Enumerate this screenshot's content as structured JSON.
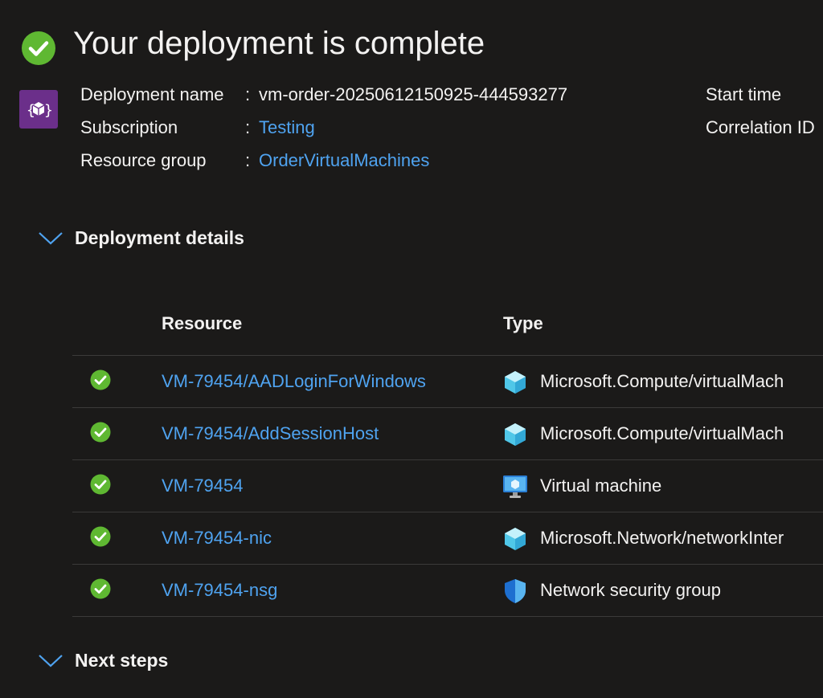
{
  "page": {
    "title": "Your deployment is complete"
  },
  "info": {
    "deployment_name_label": "Deployment name",
    "deployment_name_value": "vm-order-20250612150925-444593277",
    "subscription_label": "Subscription",
    "subscription_value": "Testing",
    "resource_group_label": "Resource group",
    "resource_group_value": "OrderVirtualMachines",
    "start_time_label": "Start time",
    "correlation_id_label": "Correlation ID",
    "separator": ":"
  },
  "details": {
    "heading": "Deployment details",
    "columns": {
      "resource": "Resource",
      "type": "Type"
    },
    "rows": [
      {
        "resource": "VM-79454/AADLoginForWindows",
        "type": "Microsoft.Compute/virtualMach",
        "icon": "cube-icon",
        "status": "succeeded"
      },
      {
        "resource": "VM-79454/AddSessionHost",
        "type": "Microsoft.Compute/virtualMach",
        "icon": "cube-icon",
        "status": "succeeded"
      },
      {
        "resource": "VM-79454",
        "type": "Virtual machine",
        "icon": "monitor-icon",
        "status": "succeeded"
      },
      {
        "resource": "VM-79454-nic",
        "type": "Microsoft.Network/networkInter",
        "icon": "cube-icon",
        "status": "succeeded"
      },
      {
        "resource": "VM-79454-nsg",
        "type": "Network security group",
        "icon": "shield-icon",
        "status": "succeeded"
      }
    ]
  },
  "next_steps": {
    "heading": "Next steps"
  },
  "colors": {
    "background": "#1b1a19",
    "link": "#4fa3f0",
    "success": "#5fb832",
    "divider": "#3b3a39"
  }
}
